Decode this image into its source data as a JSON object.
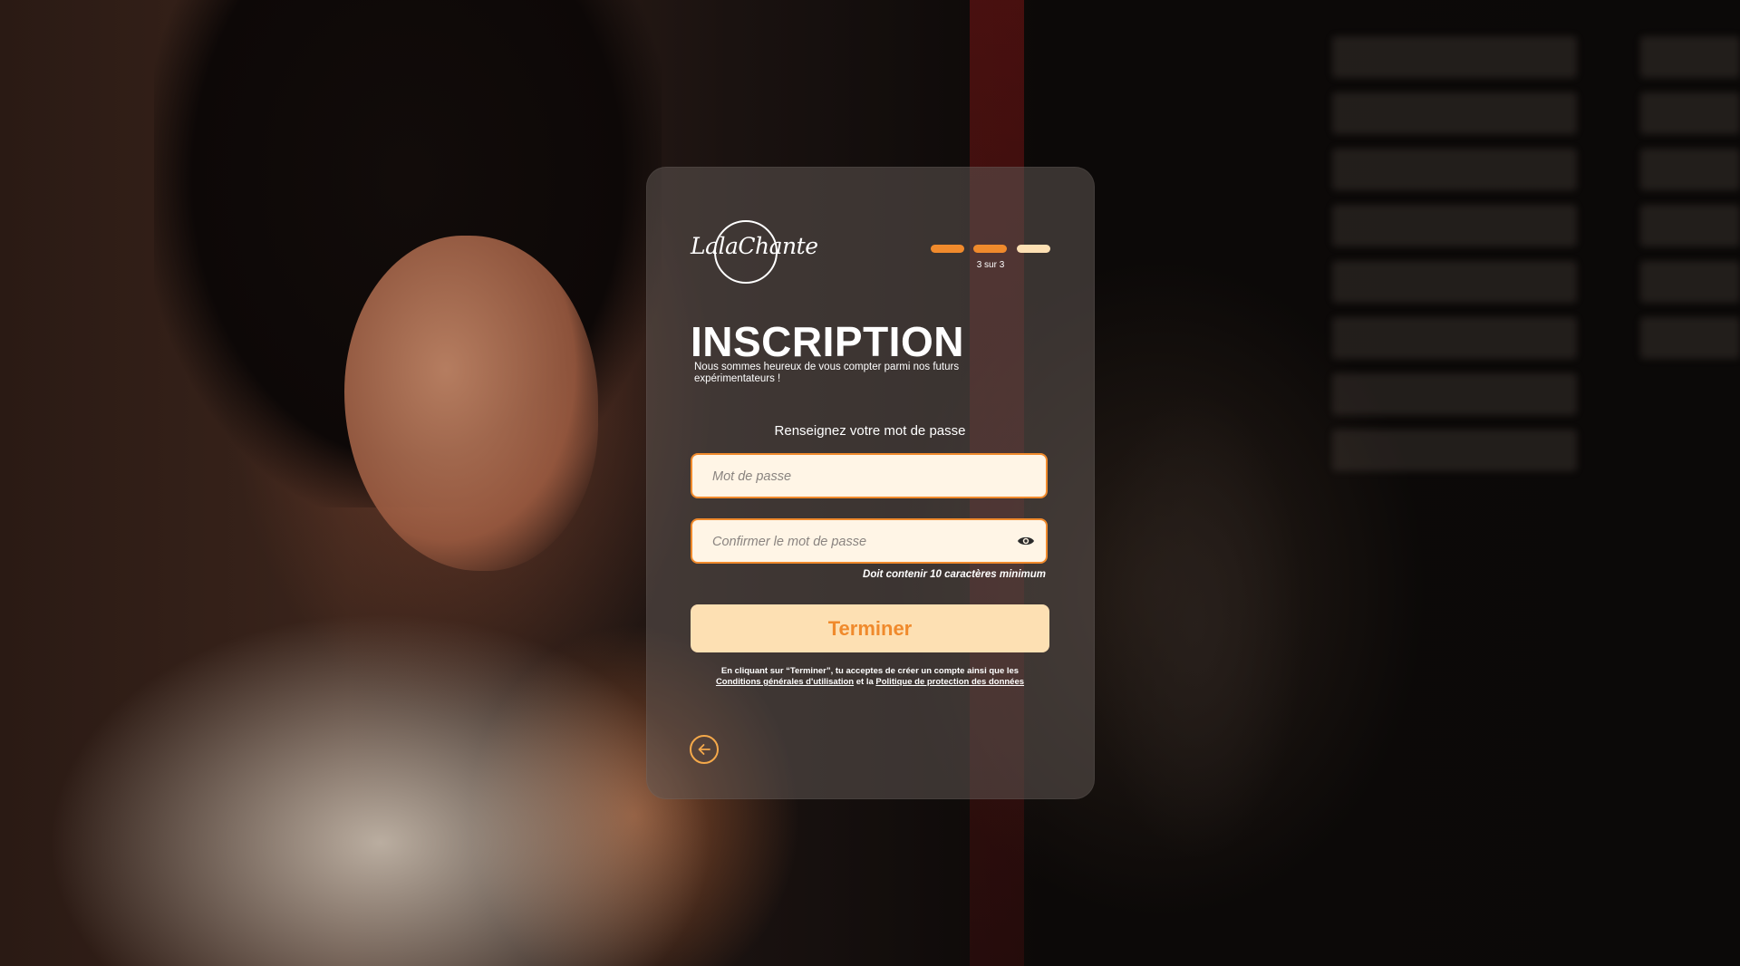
{
  "app": {
    "logo_text": "LalaChante"
  },
  "progress": {
    "label": "3 sur 3",
    "current_step": 3,
    "total_steps": 3,
    "colors": [
      "#f08a2c",
      "#f08a2c",
      "#fde0b3"
    ]
  },
  "header": {
    "title": "INSCRIPTION",
    "subtitle": "Nous sommes heureux de vous compter parmi nos futurs expérimentateurs !"
  },
  "form": {
    "section_label": "Renseignez votre mot de passe",
    "password_placeholder": "Mot de passe",
    "confirm_placeholder": "Confirmer le mot de passe",
    "hint": "Doit contenir 10 caractères minimum",
    "submit_label": "Terminer"
  },
  "legal": {
    "text_before": "En cliquant sur “Terminer”, tu acceptes de créer un compte ainsi que les",
    "terms_link": "Conditions générales d'utilisation",
    "connector": "et la",
    "privacy_link": "Politique de protection des données"
  },
  "icons": {
    "eye": "eye-icon",
    "back": "arrow-left-icon"
  },
  "colors": {
    "accent": "#f08a2c",
    "accent_light": "#fde0b3",
    "field_bg": "#fff5e6"
  }
}
